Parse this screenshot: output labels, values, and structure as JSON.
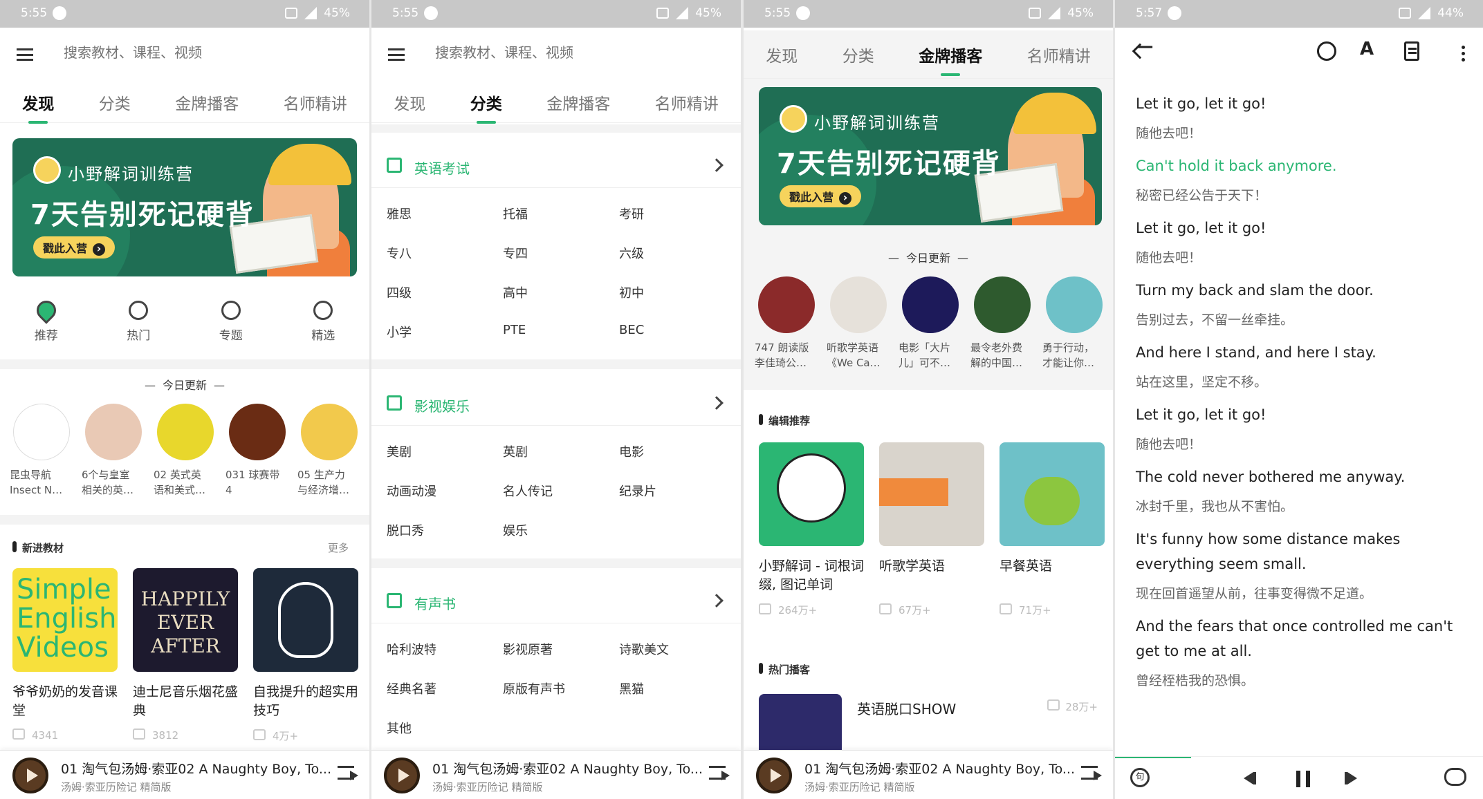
{
  "status_bars": [
    {
      "time": "5:55",
      "battery": "45%"
    },
    {
      "time": "5:55",
      "battery": "45%"
    },
    {
      "time": "5:55",
      "battery": "45%"
    },
    {
      "time": "5:57",
      "battery": "44%"
    }
  ],
  "search": {
    "placeholder": "搜索教材、课程、视频"
  },
  "tabs": [
    "发现",
    "分类",
    "金牌播客",
    "名师精讲"
  ],
  "banner": {
    "subtitle": "小野解词训练营",
    "headline": "7天告别死记硬背",
    "cta": "戳此入营"
  },
  "quick_links": [
    {
      "label": "推荐",
      "icon": "heart-icon"
    },
    {
      "label": "热门",
      "icon": "fire-icon"
    },
    {
      "label": "专题",
      "icon": "bulb-icon"
    },
    {
      "label": "精选",
      "icon": "medal-icon"
    }
  ],
  "today_update": {
    "title": "今日更新",
    "panel1_items": [
      {
        "line1": "昆虫导航",
        "line2": "Insect N…",
        "color": "#ffffff"
      },
      {
        "line1": "6个与皇室",
        "line2": "相关的英…",
        "color": "#e9c9b5"
      },
      {
        "line1": "02 英式英",
        "line2": "语和美式…",
        "color": "#e8d72c"
      },
      {
        "line1": "031 球赛带",
        "line2": "4",
        "color": "#6a2c14"
      },
      {
        "line1": "05 生产力",
        "line2": "与经济增…",
        "color": "#f2c94c"
      }
    ],
    "panel3_items": [
      {
        "line1": "747 朗读版",
        "line2": "李佳琦公…",
        "color": "#8b2a2a"
      },
      {
        "line1": "听歌学英语",
        "line2": "《We Ca…",
        "color": "#e6e1da"
      },
      {
        "line1": "电影「大片",
        "line2": "儿」可不…",
        "color": "#1d1a5a"
      },
      {
        "line1": "最令老外费",
        "line2": "解的中国…",
        "color": "#2e5a2e"
      },
      {
        "line1": "勇于行动，",
        "line2": "才能让你…",
        "color": "#6ec1c8"
      }
    ]
  },
  "new_materials": {
    "title": "新进教材",
    "more": "更多",
    "items": [
      {
        "title": "爷爷奶奶的发音课堂",
        "plays": "4341",
        "cover_text": "Simple English Videos",
        "color": "#f7e03c"
      },
      {
        "title": "迪士尼音乐烟花盛典",
        "plays": "3812",
        "cover_text": "HAPPILY EVER AFTER",
        "color": "#1d1a2e"
      },
      {
        "title": "自我提升的超实用技巧",
        "plays": "4万+",
        "cover_text": "",
        "color": "#1e2a3a"
      }
    ]
  },
  "now_playing": {
    "title": "01 淘气包汤姆·索亚02 A Naughty Boy, To...",
    "subtitle": "汤姆·索亚历险记 精简版"
  },
  "categories": [
    {
      "title": "英语考试",
      "items": [
        "雅思",
        "托福",
        "考研",
        "专八",
        "专四",
        "六级",
        "四级",
        "高中",
        "初中",
        "小学",
        "PTE",
        "BEC"
      ]
    },
    {
      "title": "影视娱乐",
      "items": [
        "美剧",
        "英剧",
        "电影",
        "动画动漫",
        "名人传记",
        "纪录片",
        "脱口秀",
        "娱乐"
      ]
    },
    {
      "title": "有声书",
      "items": [
        "哈利波特",
        "影视原著",
        "诗歌美文",
        "经典名著",
        "原版有声书",
        "黑猫",
        "其他"
      ]
    }
  ],
  "editor_picks": {
    "title": "编辑推荐",
    "items": [
      {
        "title": "小野解词 - 词根词缀, 图记单词",
        "plays": "264万+",
        "color": "#2bb673"
      },
      {
        "title": "听歌学英语",
        "plays": "67万+",
        "color": "#d9d4cc"
      },
      {
        "title": "早餐英语",
        "plays": "71万+",
        "color": "#6ec1c8"
      }
    ]
  },
  "hot_podcasts": {
    "title": "热门播客",
    "items": [
      {
        "title": "英语脱口SHOW",
        "plays": "28万+"
      }
    ]
  },
  "lyrics": [
    {
      "en": "Let it go, let it go!",
      "cn": "随他去吧！",
      "current": false
    },
    {
      "en": "Can't hold it back anymore.",
      "cn": "秘密已经公告于天下！",
      "current": true
    },
    {
      "en": "Let it go, let it go!",
      "cn": "随他去吧！",
      "current": false
    },
    {
      "en": "Turn my back and slam the door.",
      "cn": "告别过去，不留一丝牵挂。",
      "current": false
    },
    {
      "en": "And here I stand, and here I stay.",
      "cn": "站在这里，坚定不移。",
      "current": false
    },
    {
      "en": "Let it go, let it go!",
      "cn": "随他去吧！",
      "current": false
    },
    {
      "en": "The cold never bothered me anyway.",
      "cn": "冰封千里，我也从不害怕。",
      "current": false
    },
    {
      "en": "It's funny how some distance makes everything seem small.",
      "cn": "现在回首遥望从前，往事变得微不足道。",
      "current": false
    },
    {
      "en": "And the fears that once controlled me can't get to me at all.",
      "cn": "曾经桎梏我的恐惧。",
      "current": false
    }
  ],
  "reader_controls": {
    "sentence_label": "句"
  },
  "colors": {
    "accent": "#2bb673",
    "statusbar": "#c8c8c8"
  }
}
